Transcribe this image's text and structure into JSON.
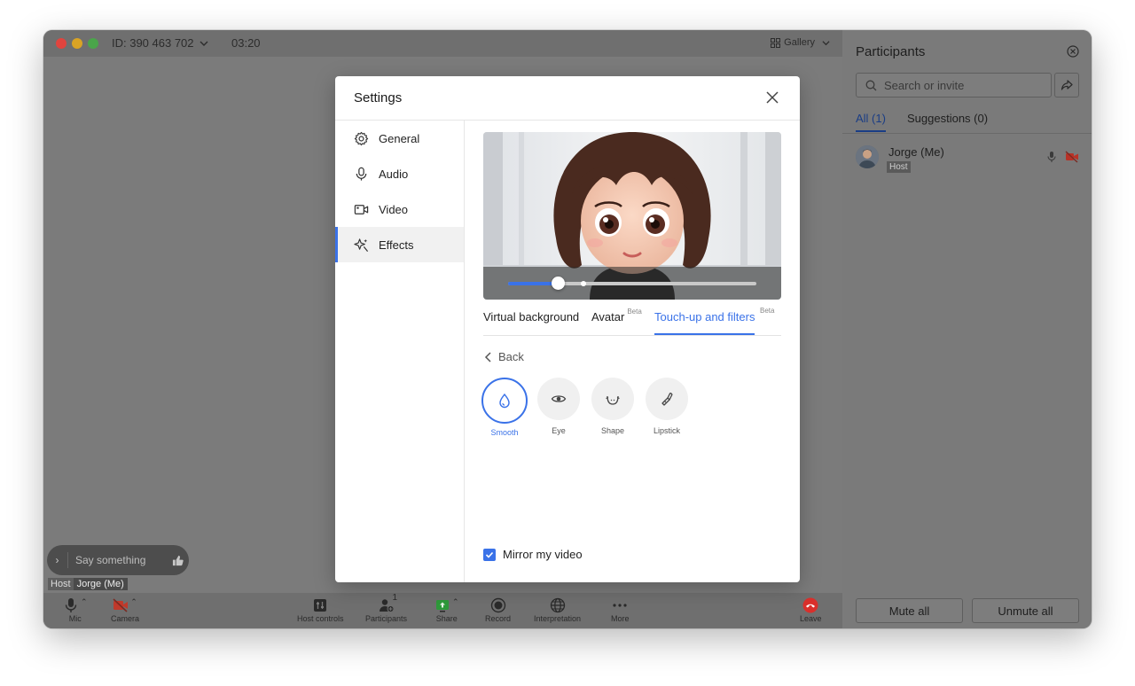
{
  "meeting": {
    "id_label": "ID: 390 463 702",
    "timer": "03:20",
    "view_mode": "Gallery",
    "chat_placeholder": "Say something",
    "name_tag": {
      "role": "Host",
      "name": "Jorge (Me)"
    }
  },
  "toolbar": {
    "mic": "Mic",
    "camera": "Camera",
    "host_controls": "Host controls",
    "participants": "Participants",
    "participants_count": "1",
    "share": "Share",
    "record": "Record",
    "interpretation": "Interpretation",
    "more": "More",
    "leave": "Leave"
  },
  "participants_panel": {
    "title": "Participants",
    "search_placeholder": "Search or invite",
    "tabs": [
      {
        "label": "All (1)",
        "active": true
      },
      {
        "label": "Suggestions (0)",
        "active": false
      }
    ],
    "rows": [
      {
        "name": "Jorge (Me)",
        "badge": "Host"
      }
    ],
    "mute_all": "Mute all",
    "unmute_all": "Unmute all"
  },
  "settings": {
    "title": "Settings",
    "nav": [
      {
        "label": "General",
        "icon": "gear-icon"
      },
      {
        "label": "Audio",
        "icon": "microphone-icon"
      },
      {
        "label": "Video",
        "icon": "video-camera-icon"
      },
      {
        "label": "Effects",
        "icon": "sparkle-icon",
        "active": true
      }
    ],
    "tabs": [
      {
        "label": "Virtual background"
      },
      {
        "label": "Avatar",
        "badge": "Beta"
      },
      {
        "label": "Touch-up and filters",
        "badge": "Beta",
        "active": true
      }
    ],
    "back": "Back",
    "effects": [
      {
        "label": "Smooth",
        "active": true
      },
      {
        "label": "Eye"
      },
      {
        "label": "Shape"
      },
      {
        "label": "Lipstick"
      }
    ],
    "slider_value": 0.2,
    "mirror_label": "Mirror my video",
    "mirror_checked": true
  },
  "colors": {
    "accent": "#3a72e8",
    "leave": "#d9302c",
    "share": "#2e9a3a"
  }
}
